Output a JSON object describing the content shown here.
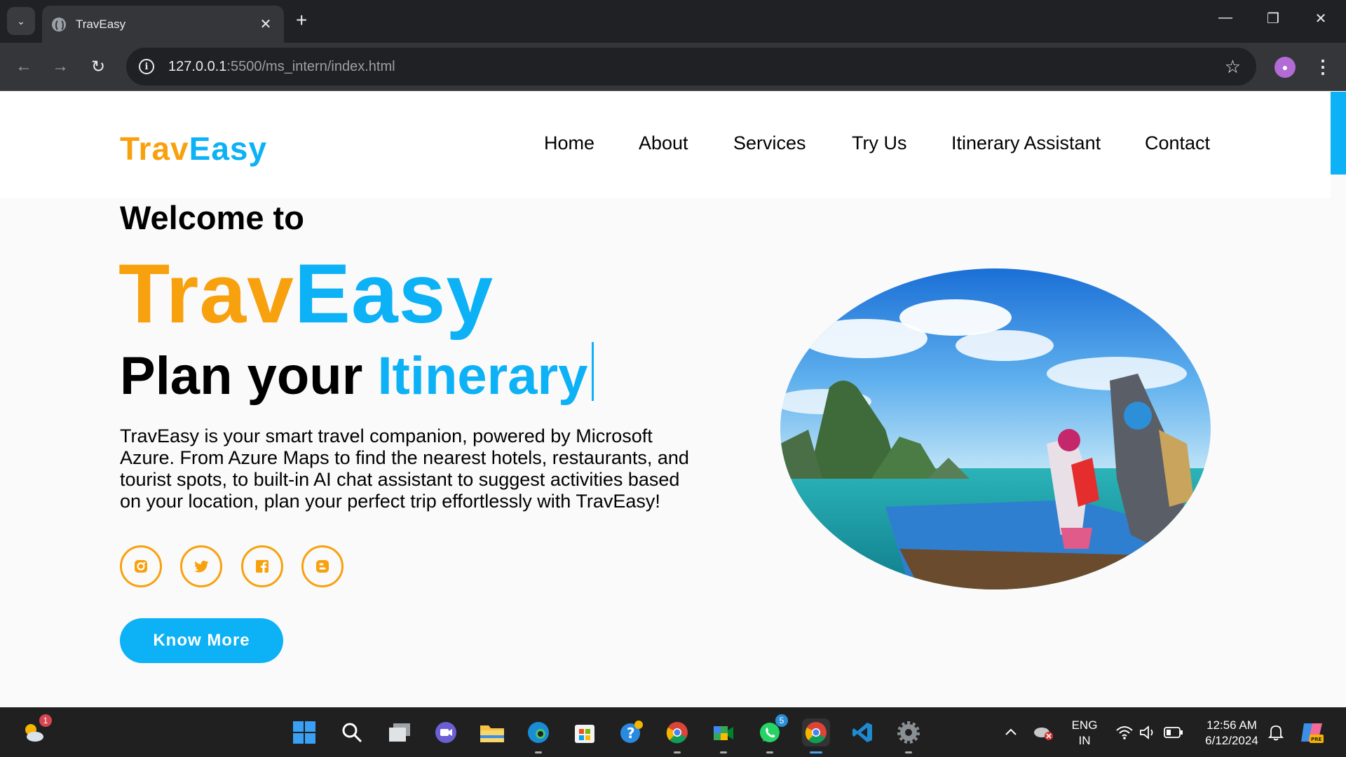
{
  "browser": {
    "tab_title": "TravEasy",
    "url_host": "127.0.0.1",
    "url_rest": ":5500/ms_intern/index.html",
    "icons": [
      "tab-search-icon",
      "globe-icon",
      "close-icon",
      "plus-icon",
      "minimize-icon",
      "restore-icon",
      "close-window-icon",
      "back-icon",
      "forward-icon",
      "reload-icon",
      "info-icon",
      "star-icon",
      "profile-icon",
      "kebab-menu-icon"
    ]
  },
  "site": {
    "logo": {
      "part1": "Trav",
      "part2": "Easy"
    },
    "nav": [
      "Home",
      "About",
      "Services",
      "Try Us",
      "Itinerary Assistant",
      "Contact"
    ],
    "hero": {
      "welcome": "Welcome to",
      "brand_part1": "Trav",
      "brand_part2": "Easy",
      "plan_prefix": "Plan your",
      "plan_highlight": "Itinerary",
      "description": "TravEasy is your smart travel companion, powered by Microsoft Azure. From Azure Maps to find the nearest hotels, restaurants, and tourist spots, to built-in AI chat assistant to suggest activities based on your location, plan your perfect trip effortlessly with TravEasy!",
      "button": "Know More"
    },
    "socials": [
      "instagram-icon",
      "twitter-icon",
      "facebook-icon",
      "blogger-icon"
    ],
    "colors": {
      "orange": "#f8a10e",
      "blue": "#0cb1f6"
    }
  },
  "taskbar": {
    "weather_badge": "1",
    "whatsapp_badge": "5",
    "language_line1": "ENG",
    "language_line2": "IN",
    "time": "12:56 AM",
    "date": "6/12/2024"
  }
}
